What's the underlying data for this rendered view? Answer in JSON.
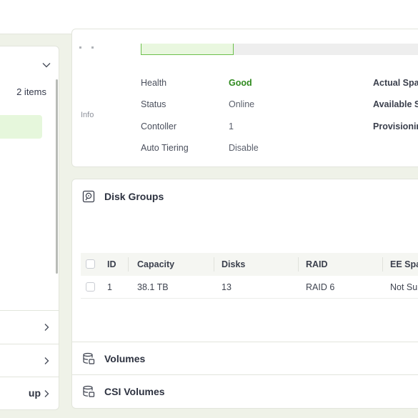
{
  "left_panel": {
    "items_count": "2 items",
    "rows": [
      {
        "label": ""
      },
      {
        "label": ""
      },
      {
        "label": "up"
      }
    ]
  },
  "info": {
    "section_label": "Info",
    "fields": [
      {
        "key": "Health",
        "value": "Good"
      },
      {
        "key": "Status",
        "value": "Online"
      },
      {
        "key": "Contoller",
        "value": "1"
      },
      {
        "key": "Auto Tiering",
        "value": "Disable"
      }
    ],
    "right_fields": [
      "Actual Spac",
      "Available S",
      "Provisionin"
    ]
  },
  "disk_groups": {
    "title": "Disk Groups",
    "columns": [
      "ID",
      "Capacity",
      "Disks",
      "RAID",
      "EE Spar"
    ],
    "rows": [
      {
        "id": "1",
        "capacity": "38.1 TB",
        "disks": "13",
        "raid": "RAID 6",
        "ee_spare": "Not Su"
      }
    ]
  },
  "sections": {
    "volumes": "Volumes",
    "csi_volumes": "CSI Volumes"
  },
  "colors": {
    "accent_green": "#2f8a1e",
    "selected_bg": "#e6f7dc",
    "page_bg": "#eff2e8"
  }
}
